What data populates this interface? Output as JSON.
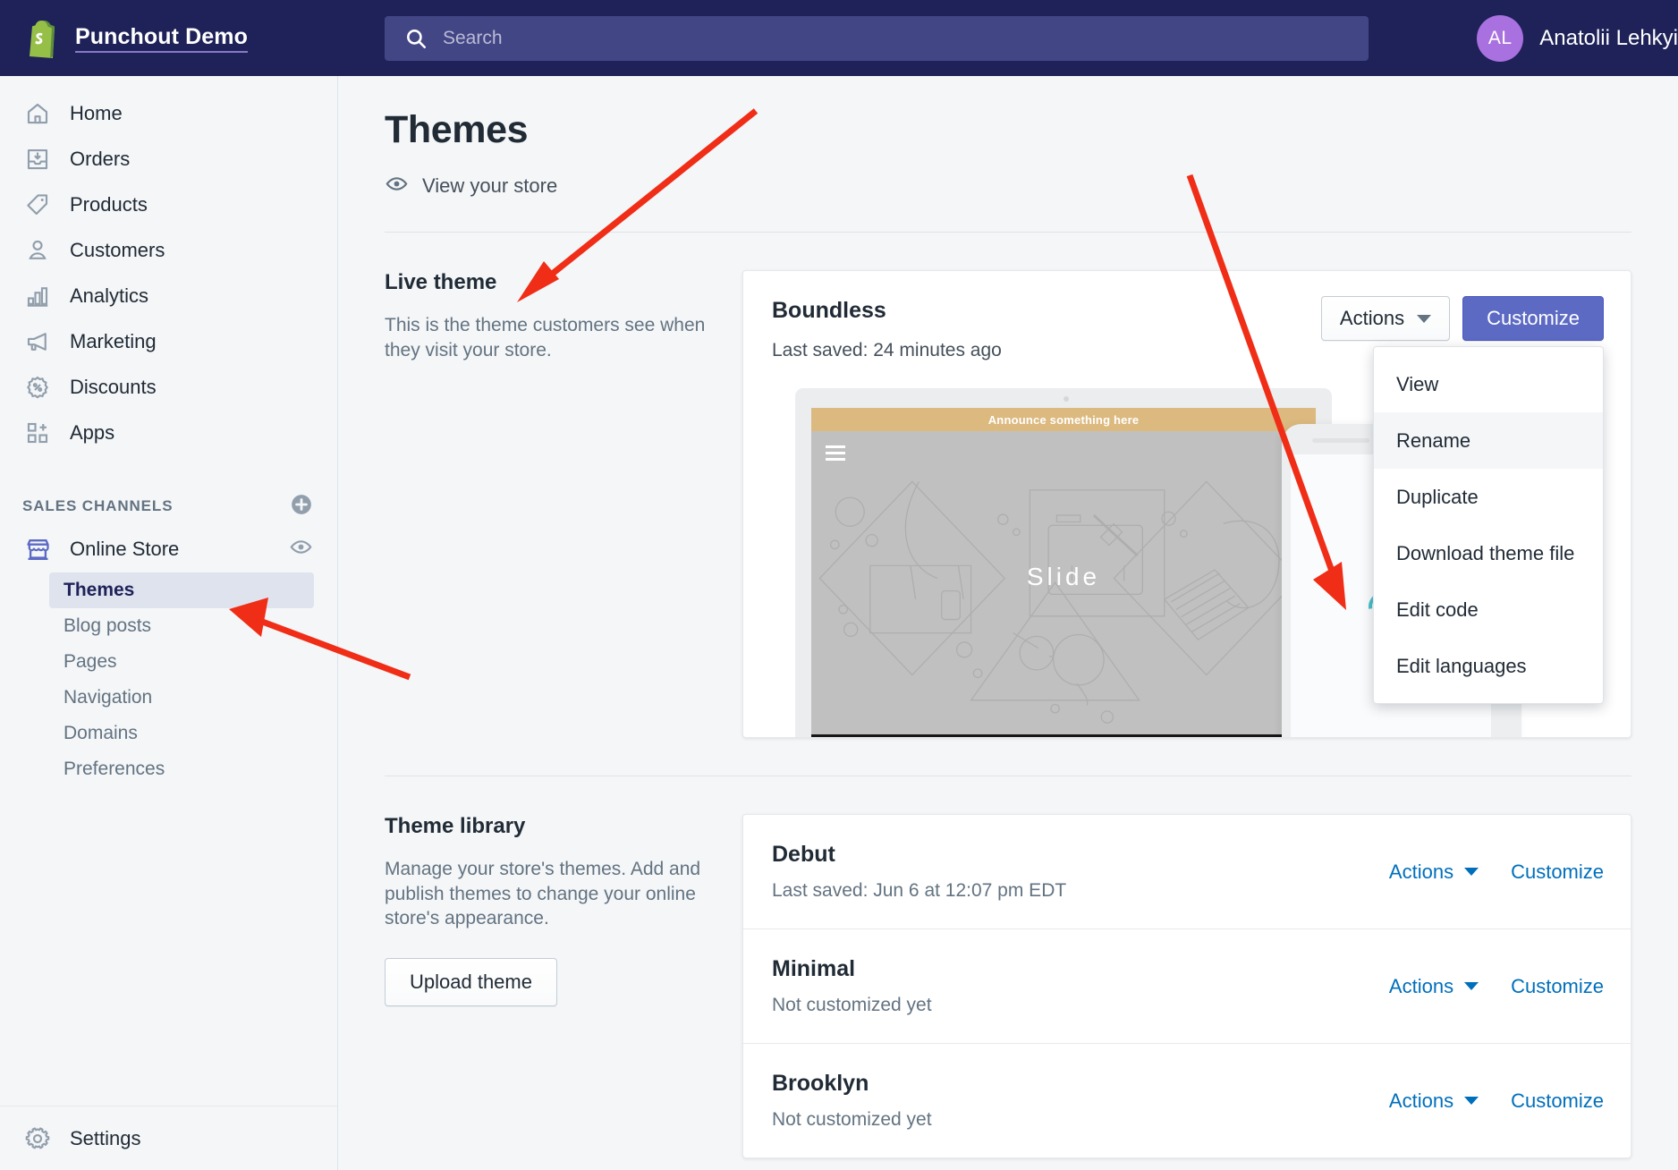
{
  "topbar": {
    "brand_name": "Punchout Demo",
    "logo_icon": "shopify-bag-icon",
    "search_placeholder": "Search",
    "search_value": "",
    "search_icon": "search-icon",
    "user_initials": "AL",
    "user_name": "Anatolii Lehkyi",
    "bg_color": "#1f2259",
    "avatar_color": "#a971e0"
  },
  "sidebar": {
    "items": [
      {
        "label": "Home",
        "icon": "home-icon"
      },
      {
        "label": "Orders",
        "icon": "orders-inbox-icon"
      },
      {
        "label": "Products",
        "icon": "product-tag-icon"
      },
      {
        "label": "Customers",
        "icon": "customer-person-icon"
      },
      {
        "label": "Analytics",
        "icon": "analytics-bars-icon"
      },
      {
        "label": "Marketing",
        "icon": "marketing-megaphone-icon"
      },
      {
        "label": "Discounts",
        "icon": "discount-percent-icon"
      },
      {
        "label": "Apps",
        "icon": "apps-grid-plus-icon"
      }
    ],
    "sales_channels": {
      "title": "SALES CHANNELS",
      "add_icon": "plus-circle-icon",
      "channel": {
        "label": "Online Store",
        "icon": "storefront-icon",
        "view_icon": "eye-icon"
      },
      "sub_items": [
        {
          "label": "Themes",
          "active": true
        },
        {
          "label": "Blog posts",
          "active": false
        },
        {
          "label": "Pages",
          "active": false
        },
        {
          "label": "Navigation",
          "active": false
        },
        {
          "label": "Domains",
          "active": false
        },
        {
          "label": "Preferences",
          "active": false
        }
      ]
    },
    "settings": {
      "label": "Settings",
      "icon": "gear-icon"
    }
  },
  "main": {
    "page_title": "Themes",
    "view_store": {
      "label": "View your store",
      "icon": "eye-icon"
    },
    "live_theme": {
      "heading": "Live theme",
      "body": "This is the theme customers see when they visit your store.",
      "card": {
        "name": "Boundless",
        "meta": "Last saved: 24 minutes ago",
        "actions_label": "Actions",
        "customize_label": "Customize",
        "customize_color": "#5c6ac4",
        "preview": {
          "announcement": "Announce something here",
          "slide_label": "Slide",
          "menu_icon": "hamburger-icon",
          "spinner_icon": "loading-spinner-icon",
          "spinner_color": "#47c1c8",
          "announcement_color": "#dcb97f"
        }
      }
    },
    "dropdown": {
      "items": [
        {
          "label": "View",
          "hovered": false
        },
        {
          "label": "Rename",
          "hovered": true
        },
        {
          "label": "Duplicate",
          "hovered": false
        },
        {
          "label": "Download theme file",
          "hovered": false
        },
        {
          "label": "Edit code",
          "hovered": false
        },
        {
          "label": "Edit languages",
          "hovered": false
        }
      ]
    },
    "theme_library": {
      "heading": "Theme library",
      "body": "Manage your store's themes. Add and publish themes to change your online store's appearance.",
      "upload_label": "Upload theme",
      "rows": [
        {
          "name": "Debut",
          "meta": "Last saved: Jun 6 at 12:07 pm EDT",
          "actions_label": "Actions",
          "customize_label": "Customize"
        },
        {
          "name": "Minimal",
          "meta": "Not customized yet",
          "actions_label": "Actions",
          "customize_label": "Customize"
        },
        {
          "name": "Brooklyn",
          "meta": "Not customized yet",
          "actions_label": "Actions",
          "customize_label": "Customize"
        }
      ]
    }
  },
  "annotations": {
    "arrow_color": "#f02d16",
    "arrows": [
      {
        "name": "arrow-to-live-theme"
      },
      {
        "name": "arrow-to-themes-sidebar"
      },
      {
        "name": "arrow-to-edit-code"
      }
    ]
  }
}
